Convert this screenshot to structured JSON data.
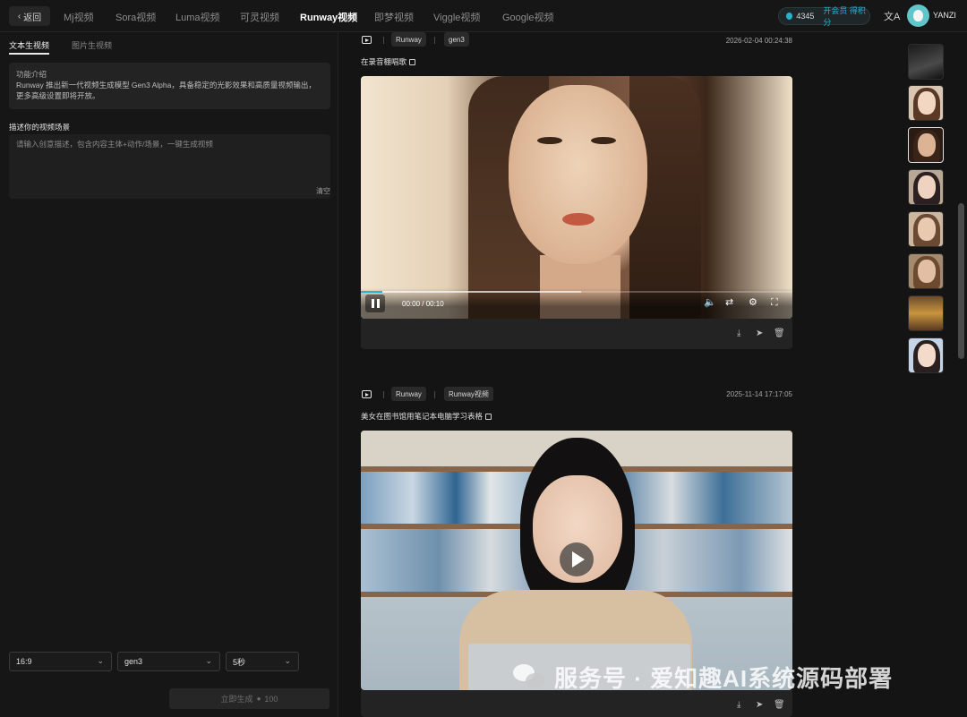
{
  "nav": {
    "back_label": "返回",
    "tabs": [
      {
        "label": "Mj视频",
        "active": false
      },
      {
        "label": "Sora视频",
        "active": false
      },
      {
        "label": "Luma视频",
        "active": false
      },
      {
        "label": "可灵视频",
        "active": false
      },
      {
        "label": "Runway视频",
        "active": true
      },
      {
        "label": "即梦视频",
        "active": false
      },
      {
        "label": "Viggle视频",
        "active": false
      },
      {
        "label": "Google视频",
        "active": false
      }
    ],
    "points": "4345",
    "vip_label": "开会员 得积分",
    "username": "YANZI",
    "translate_icon": "translate-icon",
    "accent_color": "#27b1cf"
  },
  "left": {
    "tabs": [
      {
        "label": "文本生视频",
        "active": true
      },
      {
        "label": "图片生视频",
        "active": false
      }
    ],
    "intro_title": "功能介绍",
    "intro_text": "Runway 推出新一代视频生成模型 Gen3 Alpha，具备稳定的光影效果和高质量视频输出，更多高级设置即将开放。",
    "prompt_label": "描述你的视频场景",
    "prompt_placeholder": "请输入创意描述，包含内容主体+动作/场景，一键生成视频",
    "clear_label": "清空",
    "ratio": "16:9",
    "model": "gen3",
    "duration": "5秒",
    "generate_label": "立即生成",
    "generate_cost": "100"
  },
  "feed": {
    "cards": [
      {
        "platform": "Runway",
        "model": "gen3",
        "date": "2026-02-04 00:24:38",
        "description": "在录音棚唱歌",
        "time_display": "00:00 / 00:10",
        "progress": 0.05,
        "buffered": 0.51
      },
      {
        "platform": "Runway",
        "model": "Runway视频",
        "date": "2025-11-14 17:17:05",
        "description": "美女在图书馆用笔记本电脑学习表格"
      }
    ]
  },
  "watermark": "服务号 · 爱知趣AI系统源码部署"
}
